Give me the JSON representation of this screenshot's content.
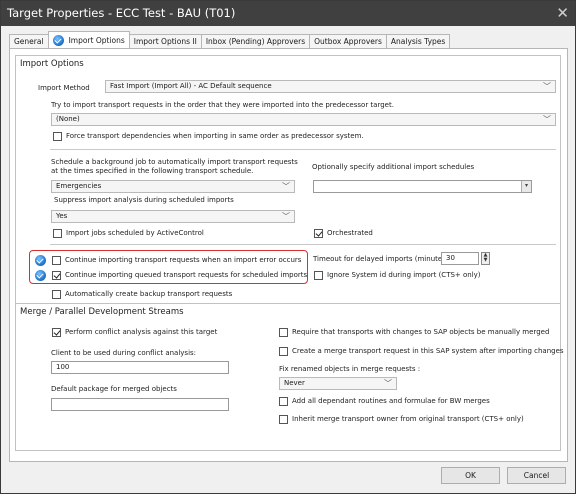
{
  "window": {
    "title": "Target Properties - ECC Test - BAU (T01)",
    "close_glyph": "✕"
  },
  "tabs": [
    {
      "label": "General",
      "active": false
    },
    {
      "label": "Import Options",
      "active": true,
      "icon": "checkmark-badge-icon"
    },
    {
      "label": "Import Options II",
      "active": false
    },
    {
      "label": "Inbox (Pending) Approvers",
      "active": false
    },
    {
      "label": "Outbox Approvers",
      "active": false
    },
    {
      "label": "Analysis Types",
      "active": false
    }
  ],
  "import_options": {
    "title": "Import Options",
    "import_method_label": "Import Method",
    "import_method_value": "Fast Import (Import All) - AC Default sequence",
    "order_label": "Try to import transport requests in the order that they were imported into the predecessor target.",
    "order_value": "(None)",
    "force_dependencies_label": "Force transport dependencies when importing in same order as predecessor system.",
    "force_dependencies_checked": false,
    "schedule_label_line1": "Schedule a background job to automatically import transport requests",
    "schedule_label_line2": "at the times specified in the following transport schedule.",
    "schedule_value": "Emergencies",
    "additional_schedules_label": "Optionally specify additional import schedules",
    "additional_schedules_value": "",
    "suppress_label": "Suppress import analysis during scheduled imports",
    "suppress_value": "Yes",
    "activecontrol_label": "Import jobs scheduled by ActiveControl",
    "activecontrol_checked": false,
    "orchestrated_label": "Orchestrated",
    "orchestrated_checked": true,
    "continue_error_label": "Continue importing transport requests when an import error occurs",
    "continue_error_checked": false,
    "continue_queued_label": "Continue importing queued transport requests for scheduled imports",
    "continue_queued_checked": true,
    "timeout_label": "Timeout for delayed imports (minutes)",
    "timeout_value": "30",
    "ignore_sysid_label": "Ignore System id during import (CTS+ only)",
    "ignore_sysid_checked": false,
    "backup_label": "Automatically create backup transport requests",
    "backup_checked": false
  },
  "merge": {
    "title": "Merge / Parallel Development Streams",
    "conflict_label": "Perform conflict analysis against this target",
    "conflict_checked": true,
    "client_label": "Client to be used during conflict analysis:",
    "client_value": "100",
    "package_label": "Default package for merged objects",
    "package_value": "",
    "require_manual_label": "Require that transports with changes to SAP objects be manually merged",
    "require_manual_checked": false,
    "create_merge_label": "Create a merge transport request in this SAP system after importing changes",
    "create_merge_checked": false,
    "fix_renamed_label": "Fix renamed objects in merge requests :",
    "fix_renamed_value": "Never",
    "add_dependant_label": "Add all dependant routines and formulae for BW merges",
    "add_dependant_checked": false,
    "inherit_owner_label": "Inherit merge transport owner from original transport (CTS+ only)",
    "inherit_owner_checked": false
  },
  "footer": {
    "ok_label": "OK",
    "cancel_label": "Cancel"
  },
  "colors": {
    "titlebar": "#404040",
    "highlight_border": "#d9302f",
    "badge": "#2a7fd4"
  }
}
